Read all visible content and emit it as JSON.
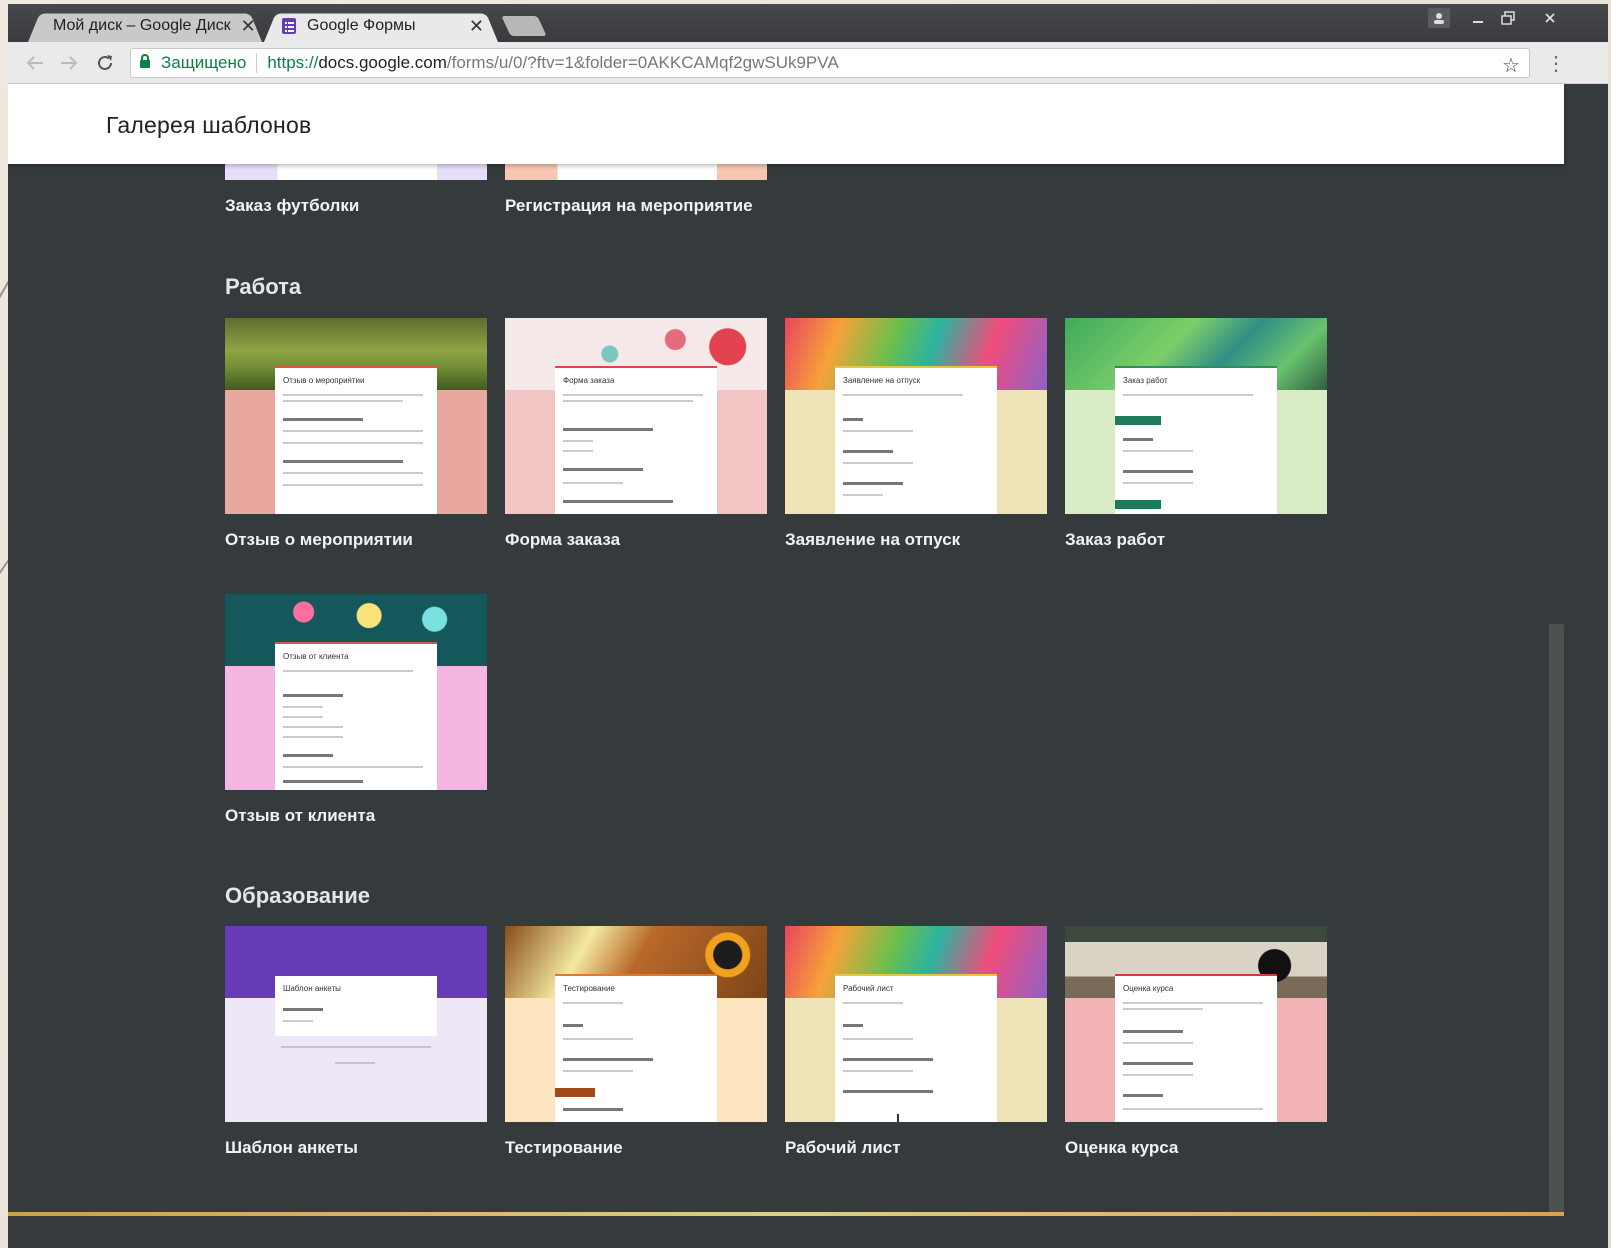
{
  "browser": {
    "tabs": [
      {
        "title": "Мой диск – Google Диск",
        "close": "✕",
        "icon": "google-drive-icon",
        "active": false
      },
      {
        "title": "Google Формы",
        "close": "✕",
        "icon": "google-forms-icon",
        "active": true
      }
    ],
    "omnibox": {
      "secure_label": "Защищено",
      "url_scheme": "https://",
      "url_host": "docs.google.com",
      "url_path": "/forms/u/0/?ftv=1&folder=0AKKCAMqf2gwSUk9PVA"
    }
  },
  "header": {
    "title": "Галерея шаблонов"
  },
  "sections": {
    "personal_partial": {
      "cards": [
        {
          "label": "Заказ футболки"
        },
        {
          "label": "Регистрация на мероприятие"
        }
      ]
    },
    "work": {
      "title": "Работа",
      "cards": [
        {
          "label": "Отзыв о мероприятии",
          "preview_title": "Отзыв о мероприятии"
        },
        {
          "label": "Форма заказа",
          "preview_title": "Форма заказа"
        },
        {
          "label": "Заявление на отпуск",
          "preview_title": "Заявление на отпуск"
        },
        {
          "label": "Заказ работ",
          "preview_title": "Заказ работ"
        },
        {
          "label": "Отзыв от клиента",
          "preview_title": "Отзыв от клиента"
        }
      ]
    },
    "education": {
      "title": "Образование",
      "cards": [
        {
          "label": "Шаблон анкеты",
          "preview_title": "Шаблон анкеты"
        },
        {
          "label": "Тестирование",
          "preview_title": "Тестирование"
        },
        {
          "label": "Рабочий лист",
          "preview_title": "Рабочий лист"
        },
        {
          "label": "Оценка курса",
          "preview_title": "Оценка курса"
        }
      ]
    }
  },
  "colors": {
    "background": "#353b3c",
    "header": "#ffffff",
    "secure_green": "#0b8043",
    "forms_purple": "#673ab7"
  }
}
